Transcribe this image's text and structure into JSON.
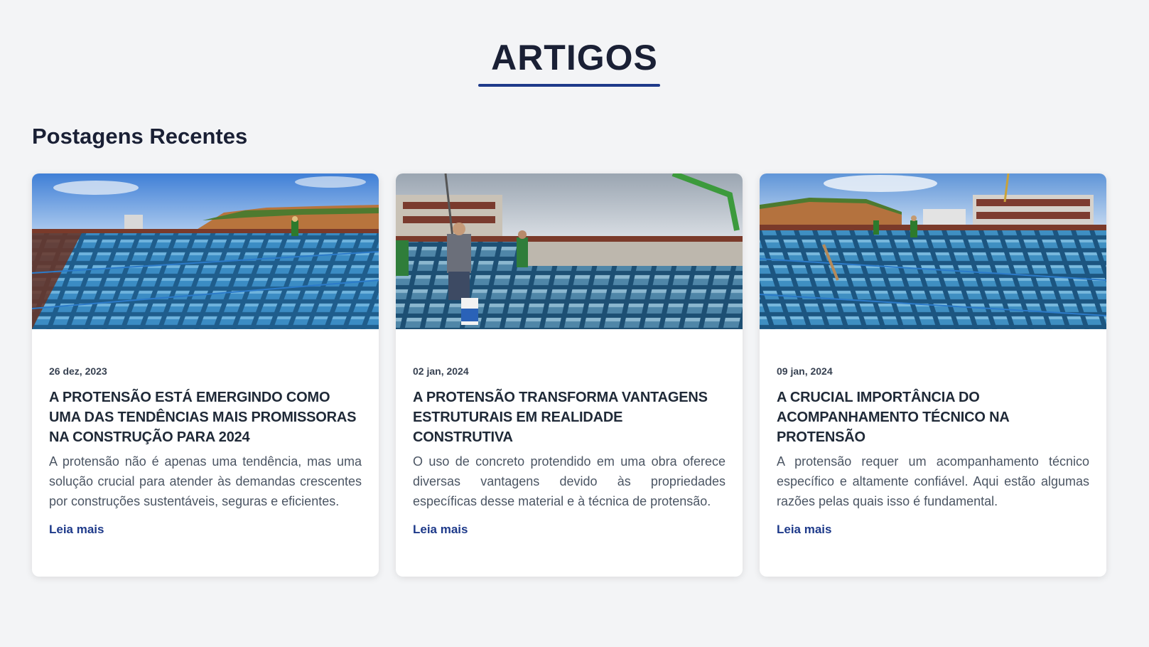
{
  "page": {
    "title": "ARTIGOS",
    "section_heading": "Postagens Recentes"
  },
  "colors": {
    "accent": "#1e3a8a",
    "background": "#f3f4f6",
    "card": "#ffffff",
    "heading": "#1a2035"
  },
  "posts": [
    {
      "date": "26 dez, 2023",
      "title": "A PROTENSÃO ESTÁ EMERGINDO COMO UMA DAS TENDÊNCIAS MAIS PROMISSORAS NA CONSTRUÇÃO PARA 2024",
      "excerpt": "A protensão não é apenas uma tendência, mas uma solução crucial para atender às demandas crescentes por construções sustentáveis, seguras e eficientes.",
      "link_label": "Leia mais"
    },
    {
      "date": "02 jan, 2024",
      "title": "A PROTENSÃO TRANSFORMA VANTAGENS ESTRUTURAIS EM REALIDADE CONSTRUTIVA",
      "excerpt": "O uso de concreto protendido em uma obra oferece diversas vantagens devido às propriedades específicas desse material e à técnica de protensão.",
      "link_label": "Leia mais"
    },
    {
      "date": "09 jan, 2024",
      "title": "A CRUCIAL IMPORTÂNCIA DO ACOMPANHAMENTO TÉCNICO NA PROTENSÃO",
      "excerpt": "A protensão requer um acompanhamento técnico específico e altamente confiável. Aqui estão algumas razões pelas quais isso é fundamental.",
      "link_label": "Leia mais"
    }
  ]
}
